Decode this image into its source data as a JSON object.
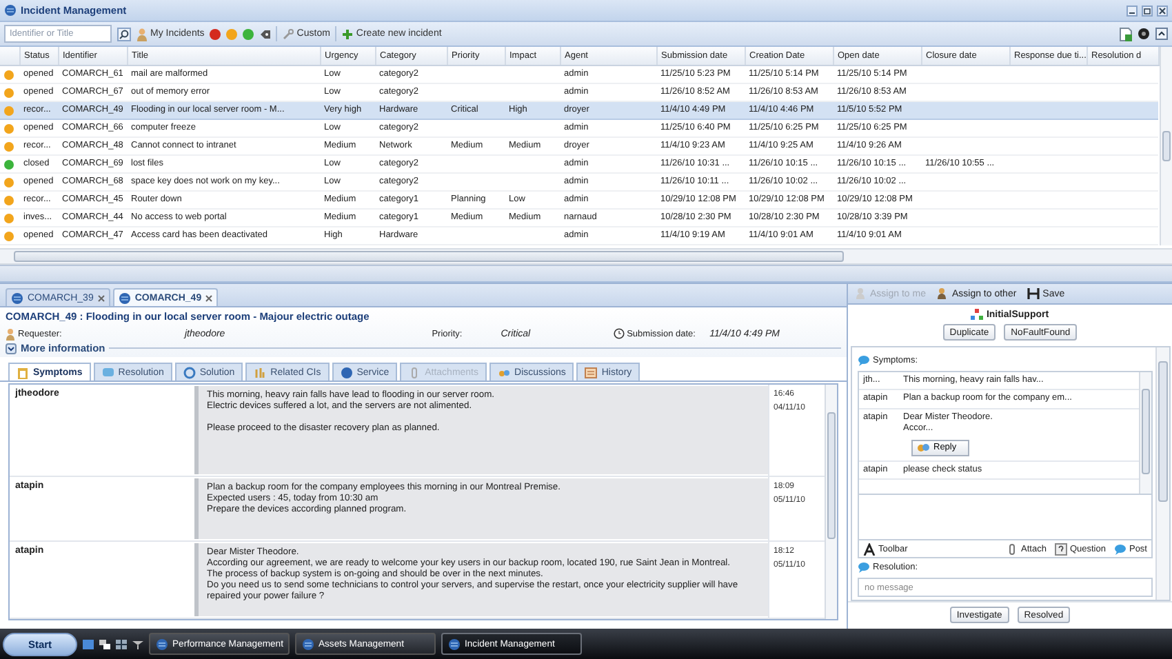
{
  "window": {
    "title": "Incident Management"
  },
  "toolbar": {
    "search": {
      "placeholder": "Identifier or Title"
    },
    "my_incidents": "My Incidents",
    "filters": [
      {
        "color": "#d42a1e"
      },
      {
        "color": "#f2a51c"
      },
      {
        "color": "#3cb43c"
      }
    ],
    "custom": "Custom",
    "create": "Create new incident"
  },
  "incidents": {
    "columns": [
      "Status",
      "Identifier",
      "Title",
      "Urgency",
      "Category",
      "Priority",
      "Impact",
      "Agent",
      "Submission date",
      "Creation Date",
      "Open date",
      "Closure date",
      "Response due ti...",
      "Resolution d"
    ],
    "rows": [
      {
        "color": "#f2a51c",
        "selected": false,
        "cells": [
          "opened",
          "COMARCH_61",
          "mail are malformed",
          "Low",
          "category2",
          null,
          null,
          "admin",
          "11/25/10 5:23 PM",
          "11/25/10 5:14 PM",
          "11/25/10 5:14 PM",
          null,
          null,
          null
        ]
      },
      {
        "color": "#f2a51c",
        "selected": false,
        "cells": [
          "opened",
          "COMARCH_67",
          "out of memory error",
          "Low",
          "category2",
          null,
          null,
          "admin",
          "11/26/10 8:52 AM",
          "11/26/10 8:53 AM",
          "11/26/10 8:53 AM",
          null,
          null,
          null
        ]
      },
      {
        "color": "#f2a51c",
        "selected": true,
        "cells": [
          "recor...",
          "COMARCH_49",
          "Flooding in our local server room - M...",
          "Very high",
          "Hardware",
          "Critical",
          "High",
          "droyer",
          "11/4/10 4:49 PM",
          "11/4/10 4:46 PM",
          "11/5/10 5:52 PM",
          null,
          null,
          null
        ]
      },
      {
        "color": "#f2a51c",
        "selected": false,
        "cells": [
          "opened",
          "COMARCH_66",
          "computer freeze",
          "Low",
          "category2",
          null,
          null,
          "admin",
          "11/25/10 6:40 PM",
          "11/25/10 6:25 PM",
          "11/25/10 6:25 PM",
          null,
          null,
          null
        ]
      },
      {
        "color": "#f2a51c",
        "selected": false,
        "cells": [
          "recor...",
          "COMARCH_48",
          "Cannot connect to intranet",
          "Medium",
          "Network",
          "Medium",
          "Medium",
          "droyer",
          "11/4/10 9:23 AM",
          "11/4/10 9:25 AM",
          "11/4/10 9:26 AM",
          null,
          null,
          null
        ]
      },
      {
        "color": "#3cb43c",
        "selected": false,
        "cells": [
          "closed",
          "COMARCH_69",
          "lost files",
          "Low",
          "category2",
          null,
          null,
          "admin",
          "11/26/10 10:31 ...",
          "11/26/10 10:15 ...",
          "11/26/10 10:15 ...",
          "11/26/10 10:55 ...",
          null,
          null
        ]
      },
      {
        "color": "#f2a51c",
        "selected": false,
        "cells": [
          "opened",
          "COMARCH_68",
          "space key does not work on my key...",
          "Low",
          "category2",
          null,
          null,
          "admin",
          "11/26/10 10:11 ...",
          "11/26/10 10:02 ...",
          "11/26/10 10:02 ...",
          null,
          null,
          null
        ]
      },
      {
        "color": "#f2a51c",
        "selected": false,
        "cells": [
          "recor...",
          "COMARCH_45",
          "Router down",
          "Medium",
          "category1",
          "Planning",
          "Low",
          "admin",
          "10/29/10 12:08 PM",
          "10/29/10 12:08 PM",
          "10/29/10 12:08 PM",
          null,
          null,
          null
        ]
      },
      {
        "color": "#f2a51c",
        "selected": false,
        "cells": [
          "inves...",
          "COMARCH_44",
          "No access to web portal",
          "Medium",
          "category1",
          "Medium",
          "Medium",
          "narnaud",
          "10/28/10 2:30 PM",
          "10/28/10 2:30 PM",
          "10/28/10 3:39 PM",
          null,
          null,
          null
        ]
      },
      {
        "color": "#f2a51c",
        "selected": false,
        "cells": [
          "opened",
          "COMARCH_47",
          "Access card has been deactivated",
          "High",
          "Hardware",
          null,
          null,
          "admin",
          "11/4/10 9:19 AM",
          "11/4/10 9:01 AM",
          "11/4/10 9:01 AM",
          null,
          null,
          null
        ]
      }
    ]
  },
  "open_tabs": [
    {
      "label": "COMARCH_39",
      "selected": false
    },
    {
      "label": "COMARCH_49",
      "selected": true
    }
  ],
  "detail": {
    "heading": "COMARCH_49 : Flooding in our local server room - Majour electric outage",
    "fields": [
      {
        "kind": "requester",
        "label": "Requester:",
        "value": "jtheodore"
      },
      {
        "kind": "plain",
        "label": "Priority:",
        "value": "Critical"
      },
      {
        "kind": "date",
        "label": "Submission date:",
        "value": "11/4/10 4:49 PM"
      }
    ],
    "more": "More information",
    "tabs": [
      {
        "kind": "symptoms",
        "label": "Symptoms",
        "selected": true,
        "disabled": false
      },
      {
        "kind": "resolution",
        "label": "Resolution",
        "selected": false,
        "disabled": false
      },
      {
        "kind": "solution",
        "label": "Solution",
        "selected": false,
        "disabled": false
      },
      {
        "kind": "cis",
        "label": "Related CIs",
        "selected": false,
        "disabled": false
      },
      {
        "kind": "service",
        "label": "Service",
        "selected": false,
        "disabled": false
      },
      {
        "kind": "attachments",
        "label": "Attachments",
        "selected": false,
        "disabled": true
      },
      {
        "kind": "discussions",
        "label": "Discussions",
        "selected": false,
        "disabled": false
      },
      {
        "kind": "history",
        "label": "History",
        "selected": false,
        "disabled": false
      }
    ],
    "messages": [
      {
        "author": "jtheodore",
        "text": "This morning, heavy rain falls have lead to flooding in our server room.\nElectric devices suffered a lot, and the servers are not alimented.\n\nPlease proceed to the disaster recovery plan as planned.",
        "time": "16:46",
        "date": "04/11/10"
      },
      {
        "author": "atapin",
        "text": "Plan a backup room for the company employees this morning in our Montreal Premise.\nExpected users : 45, today from 10:30 am\nPrepare the devices according planned program.",
        "time": "18:09",
        "date": "05/11/10"
      },
      {
        "author": "atapin",
        "text": "Dear Mister Theodore.\nAccording our agreement, we are ready to welcome your key users in our backup room, located 190, rue Saint Jean in Montreal.\nThe process of backup system is on-going and should be over in the next minutes.\nDo you need us to send some technicians to control your servers, and supervise the restart, once your electricity supplier will have repaired your power failure ?",
        "time": "18:12",
        "date": "05/11/10"
      }
    ]
  },
  "side": {
    "actions": [
      {
        "kind": "assign_me",
        "label": "Assign to me",
        "disabled": true
      },
      {
        "kind": "assign_other",
        "label": "Assign to other",
        "disabled": false
      },
      {
        "kind": "save",
        "label": "Save",
        "disabled": false
      }
    ],
    "workflow": {
      "title": "InitialSupport",
      "buttons": [
        "Duplicate",
        "NoFaultFound"
      ]
    },
    "symptoms": {
      "label": "Symptoms:",
      "messages": [
        {
          "author": "jth...",
          "text": "This morning, heavy rain falls hav..."
        },
        {
          "author": "atapin",
          "text": "Plan a backup room for the company em..."
        },
        {
          "author": "atapin",
          "text": "Dear Mister Theodore.\nAccor...",
          "reply": "Reply"
        },
        {
          "author": "atapin",
          "text": "please check status"
        }
      ],
      "tools": [
        {
          "kind": "toolbar",
          "label": "Toolbar"
        },
        {
          "kind": "attach",
          "label": "Attach"
        },
        {
          "kind": "question",
          "label": "Question"
        },
        {
          "kind": "post",
          "label": "Post"
        }
      ]
    },
    "resolution": {
      "label": "Resolution:",
      "placeholder": "no message"
    },
    "buttons": [
      "Investigate",
      "Resolved"
    ]
  },
  "taskbar": {
    "start": "Start",
    "tasks": [
      {
        "label": "Performance Management",
        "selected": false
      },
      {
        "label": "Assets Management",
        "selected": false
      },
      {
        "label": "Incident Management",
        "selected": true
      }
    ]
  }
}
